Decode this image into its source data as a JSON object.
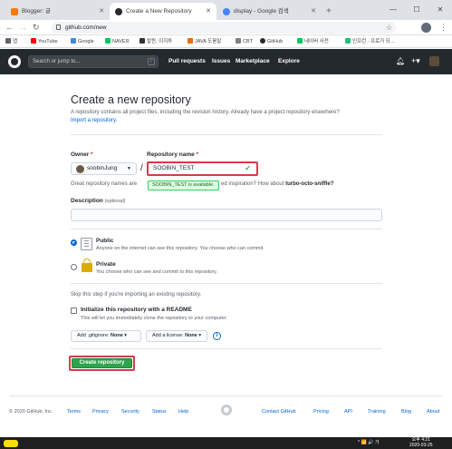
{
  "browser": {
    "tabs": [
      {
        "label": "Blogger: 글",
        "color": "#f57d00"
      },
      {
        "label": "Create a New Repository",
        "color": "#24292e"
      },
      {
        "label": "display - Google 검색",
        "color": "#4285f4"
      }
    ],
    "new_tab": "+",
    "url": "github.com/new",
    "bookmarks": [
      {
        "label": "앱",
        "color": "#5f6368"
      },
      {
        "label": "YouTube",
        "color": "#ff0000"
      },
      {
        "label": "Google",
        "color": "#4285f4"
      },
      {
        "label": "NAVER",
        "color": "#03c75a"
      },
      {
        "label": "칼뮌, 이지투",
        "color": "#333333"
      },
      {
        "label": "JAVA 도움말",
        "color": "#e76f00"
      },
      {
        "label": "CBT",
        "color": "#7f7f7f"
      },
      {
        "label": "GitHub",
        "color": "#24292e"
      },
      {
        "label": "네이버 사전",
        "color": "#03c75a"
      },
      {
        "label": "인프런 - 프로가 되…",
        "color": "#1dc078"
      }
    ]
  },
  "gh_header": {
    "search_placeholder": "Search or jump to...",
    "search_key": "/",
    "nav": [
      "Pull requests",
      "Issues",
      "Marketplace",
      "Explore"
    ],
    "plus": "+▾"
  },
  "page": {
    "title": "Create a new repository",
    "subtitle": "A repository contains all project files, including the revision history. Already have a project repository elsewhere?",
    "import_link": "Import a repository.",
    "owner_label": "Owner",
    "owner_value": "soobinJung",
    "repo_label": "Repository name",
    "required_mark": "*",
    "repo_value": "SOOBIN_TEST",
    "separator": "/",
    "great_prefix": "Great repository names are",
    "great_middle": "ed inspiration? How about",
    "suggestion": "turbo-octo-sniffle?",
    "available_tooltip": "SOOBIN_TEST is available.",
    "description_label": "Description",
    "description_optional": "(optional)",
    "public_label": "Public",
    "public_desc": "Anyone on the internet can see this repository. You choose who can commit.",
    "private_label": "Private",
    "private_desc": "You choose who can see and commit to this repository.",
    "skip_text": "Skip this step if you're importing an existing repository.",
    "init_label": "Initialize this repository with a README",
    "init_desc": "This will let you immediately clone the repository to your computer.",
    "gitignore_label": "Add .gitignore:",
    "gitignore_value": "None",
    "license_label": "Add a license:",
    "license_value": "None",
    "info_icon": "i",
    "create_button": "Create repository"
  },
  "footer": {
    "copyright": "© 2020 GitHub, Inc.",
    "left_links": [
      "Terms",
      "Privacy",
      "Security",
      "Status",
      "Help"
    ],
    "right_links": [
      "Contact GitHub",
      "Pricing",
      "API",
      "Training",
      "Blog",
      "About"
    ]
  },
  "taskbar": {
    "tray": "^ 📶 🔊 가",
    "time": "오후 4:21",
    "date": "2020-03-25"
  }
}
